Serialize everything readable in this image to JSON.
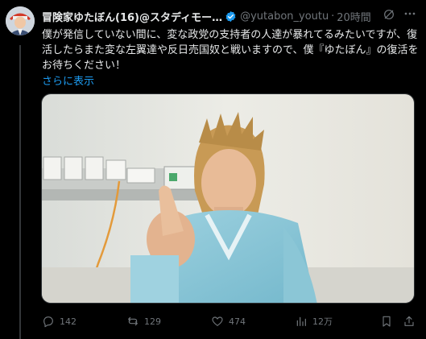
{
  "tweet": {
    "display_name": "冒険家ゆたぼん(16)@スタディモー…",
    "handle": "@yutabon_youtu...",
    "separator": "·",
    "time": "20時間",
    "body": "僕が発信していない間に、変な政党の支持者の人達が暴れてるみたいですが、復活したらまた変な左翼達や反日売国奴と戦いますので、僕『ゆたぼん』の復活をお待ちください！",
    "show_more": "さらに表示"
  },
  "actions": {
    "replies": "142",
    "reposts": "129",
    "likes": "474",
    "views": "12万"
  },
  "colors": {
    "background": "#000000",
    "text": "#e7e9ea",
    "secondary": "#71767b",
    "link": "#1d9bf0",
    "verified": "#1d9bf0"
  },
  "icons": [
    "avatar",
    "verified-badge-icon",
    "grok-icon",
    "more-icon",
    "reply-icon",
    "repost-icon",
    "like-icon",
    "views-icon",
    "bookmark-icon",
    "share-icon"
  ]
}
